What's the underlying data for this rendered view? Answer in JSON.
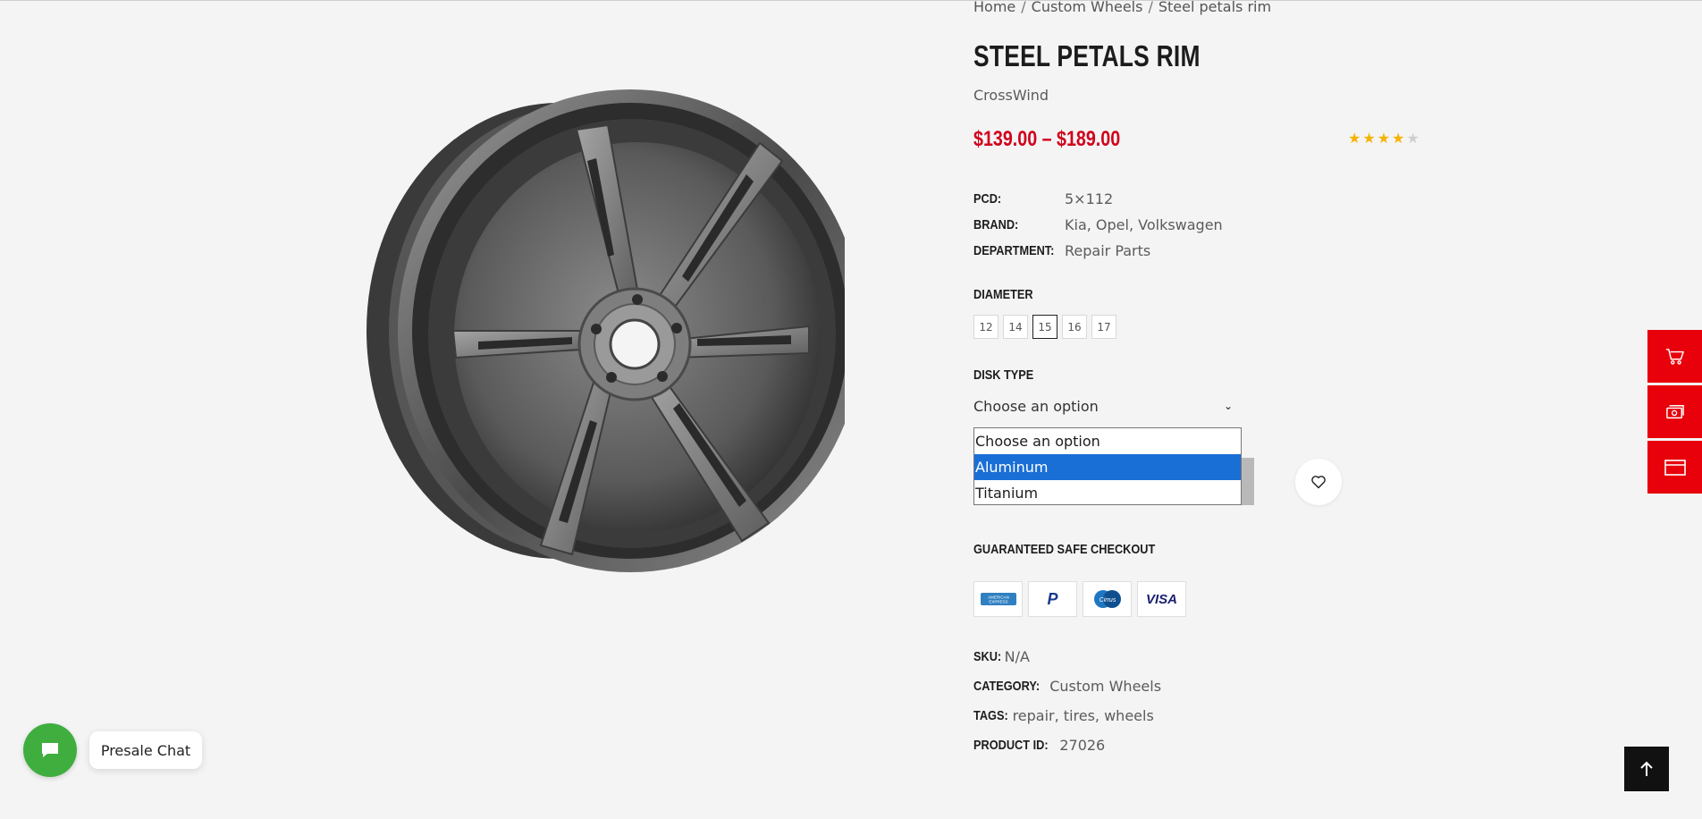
{
  "breadcrumb": {
    "items": [
      "Home",
      "Custom Wheels",
      "Steel petals rim"
    ],
    "separator": "/"
  },
  "product": {
    "title": "STEEL PETALS RIM",
    "vendor": "CrossWind",
    "price_range": "$139.00 – $189.00",
    "rating": {
      "value": 4,
      "max": 5
    },
    "image_icon": "wheel-rim-image"
  },
  "attributes": [
    {
      "key": "PCD:",
      "value": "5×112"
    },
    {
      "key": "BRAND:",
      "value": "Kia, Opel, Volkswagen"
    },
    {
      "key": "DEPARTMENT:",
      "value": "Repair Parts"
    }
  ],
  "diameter": {
    "label": "DIAMETER",
    "options": [
      "12",
      "14",
      "15",
      "16",
      "17"
    ],
    "selected": "15"
  },
  "disk_type": {
    "label": "DISK TYPE",
    "placeholder": "Choose an option",
    "options": [
      "Choose an option",
      "Aluminum",
      "Titanium"
    ],
    "highlighted": "Aluminum"
  },
  "checkout": {
    "label": "GUARANTEED SAFE CHECKOUT",
    "methods": [
      {
        "name": "american-express",
        "text": "AMERICAN EXPRESS"
      },
      {
        "name": "paypal",
        "text": "P"
      },
      {
        "name": "cirrus",
        "text": "Cirrus"
      },
      {
        "name": "visa",
        "text": "VISA"
      }
    ]
  },
  "meta": {
    "sku_key": "SKU:",
    "sku": "N/A",
    "category_key": "CATEGORY:",
    "category": "Custom Wheels",
    "tags_key": "TAGS:",
    "tags": [
      "repair",
      "tires",
      "wheels"
    ],
    "id_key": "PRODUCT ID:",
    "id": "27026"
  },
  "side_tools": [
    {
      "name": "cart-icon"
    },
    {
      "name": "money-icon"
    },
    {
      "name": "browser-window-icon"
    }
  ],
  "chat": {
    "label": "Presale Chat"
  },
  "colors": {
    "accent": "#d0021b",
    "side_tools": "#e8000b",
    "chat": "#3fae3f",
    "selected_option": "#1a6fd6",
    "star": "#f5b301"
  }
}
